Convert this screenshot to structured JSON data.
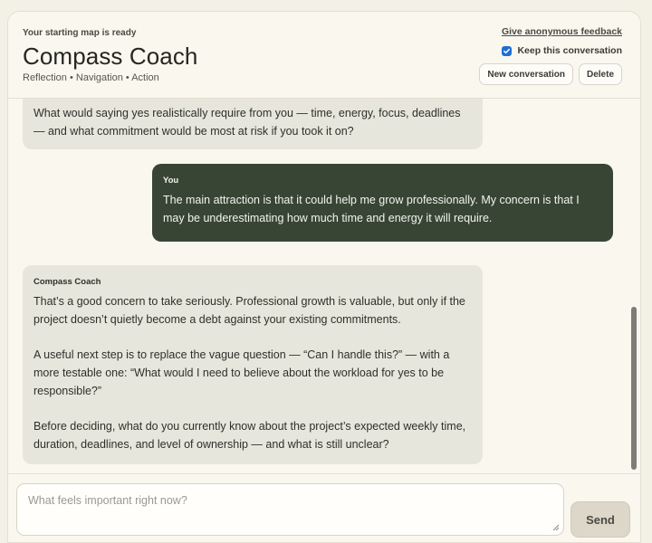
{
  "header": {
    "eyebrow": "Your starting map is ready",
    "title": "Compass Coach",
    "subtitle": "Reflection • Navigation • Action",
    "feedback_link": "Give anonymous feedback",
    "keep_label": "Keep this conversation",
    "keep_checked": true,
    "new_conversation": "New conversation",
    "delete": "Delete"
  },
  "messages": [
    {
      "role": "coach",
      "speaker": "",
      "paragraphs": [
        "What would saying yes realistically require from you — time, energy, focus, deadlines — and what commitment would be most at risk if you took it on?"
      ]
    },
    {
      "role": "user",
      "speaker": "You",
      "paragraphs": [
        "The main attraction is that it could help me grow professionally. My concern is that I may be underestimating how much time and energy it will require."
      ]
    },
    {
      "role": "coach",
      "speaker": "Compass Coach",
      "paragraphs": [
        "That’s a good concern to take seriously. Professional growth is valuable, but only if the project doesn’t quietly become a debt against your existing commitments.",
        "A useful next step is to replace the vague question — “Can I handle this?” — with a more testable one: “What would I need to believe about the workload for yes to be responsible?”",
        "Before deciding, what do you currently know about the project’s expected weekly time, duration, deadlines, and level of ownership — and what is still unclear?"
      ]
    }
  ],
  "composer": {
    "placeholder": "What feels important right now?",
    "send_label": "Send"
  },
  "colors": {
    "user_bubble": "#384535",
    "coach_bubble": "#e7e6dc",
    "checkbox": "#1f6fd1"
  }
}
